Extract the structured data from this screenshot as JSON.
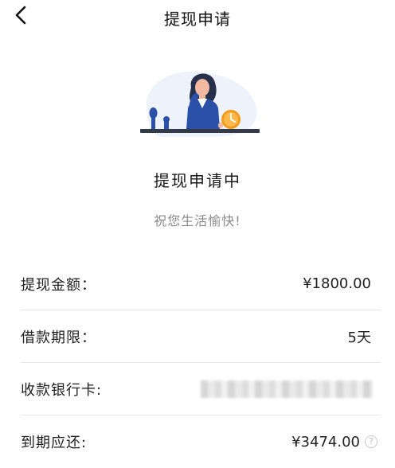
{
  "nav": {
    "title": "提现申请",
    "back_icon": "chevron-left-icon"
  },
  "status": {
    "title": "提现申请中",
    "subtitle": "祝您生活愉快!"
  },
  "details": {
    "amount_label": "提现金额：",
    "amount_value": "¥1800.00",
    "term_label": "借款期限：",
    "term_value": "5天",
    "card_label": "收款银行卡:",
    "due_label": "到期应还:",
    "due_value": "¥3474.00"
  },
  "colors": {
    "accent_blue": "#2b50a8",
    "clock_orange": "#f39a1f",
    "divider": "#e4e4e4"
  }
}
